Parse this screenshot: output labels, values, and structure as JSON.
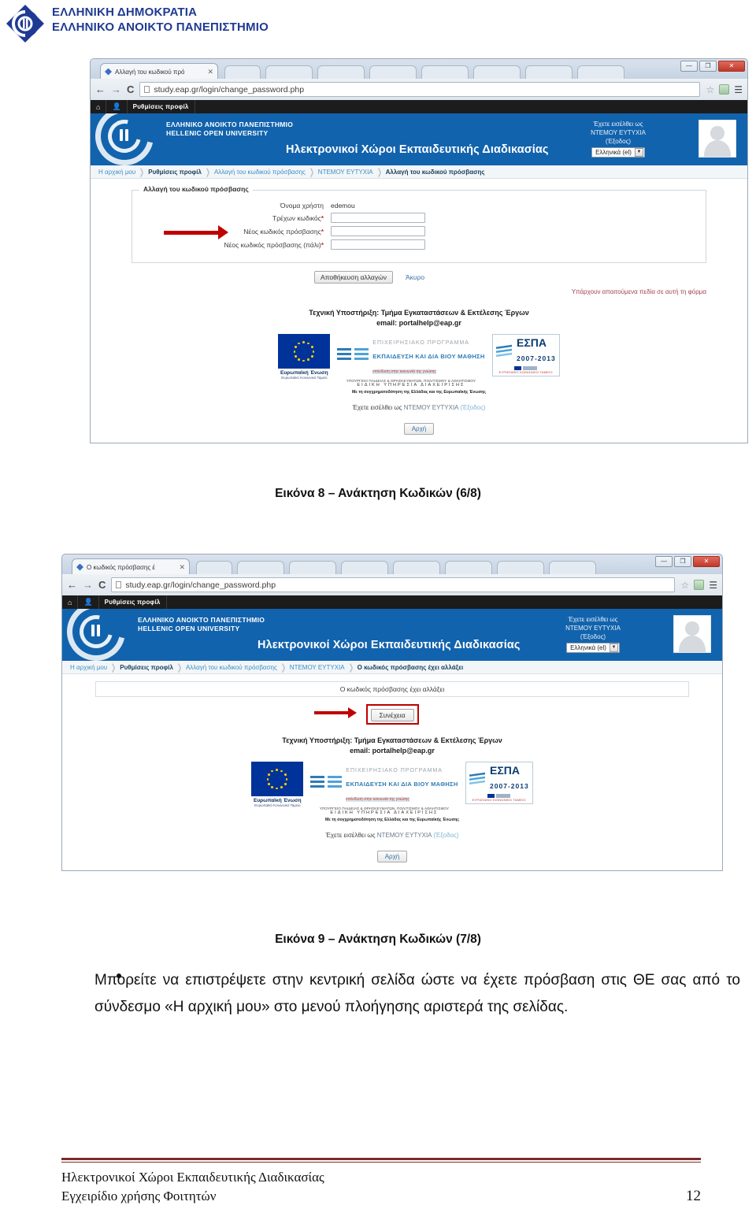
{
  "document_header": {
    "line1": "ΕΛΛΗΝΙΚΗ ΔΗΜΟΚΡΑΤΙΑ",
    "line2": "ΕΛΛΗΝΙΚΟ ΑΝΟΙΚΤΟ ΠΑΝΕΠΙΣΤΗΜΙΟ",
    "crest_icon": "eap-crest-icon",
    "brand_color": "#1f3a93"
  },
  "screenshot_1": {
    "tab": {
      "title": "Αλλαγή του κωδικού πρό",
      "close": "✕",
      "favicon": "moodle-favicon"
    },
    "window_controls": {
      "minimize": "—",
      "maximize": "❐",
      "close": "✕"
    },
    "toolbar": {
      "back": "←",
      "forward": "→",
      "reload": "C",
      "url": "study.eap.gr/login/change_password.php",
      "star": "☆",
      "extension": "extension-icon",
      "menu": "☰"
    },
    "custom_menu": {
      "home_icon": "home-icon",
      "user_icon": "user-icon",
      "profile_label": "Ρυθμίσεις προφίλ"
    },
    "site_header": {
      "logo": "eap-circle-logo",
      "uni_greek": "ΕΛΛΗΝΙΚΟ ΑΝΟΙΚΤΟ ΠΑΝΕΠΙΣΤΗΜΙΟ",
      "uni_english": "HELLENIC OPEN UNIVERSITY",
      "portal_title": "Ηλεκτρονικοί Χώροι Εκπαιδευτικής Διαδικασίας",
      "logged_in_as": "Έχετε εισέλθει ως",
      "user_name": "ΝΤΕΜΟΥ ΕΥΤΥΧΙΑ",
      "logout": "(Έξοδος)",
      "language": "Ελληνικά (el)",
      "language_arrow": "▼",
      "avatar": "user-avatar"
    },
    "breadcrumbs": [
      "Η αρχική μου",
      "Ρυθμίσεις προφίλ",
      "Αλλαγή του κωδικού πρόσβασης",
      "ΝΤΕΜΟΥ ΕΥΤΥΧΙΑ",
      "Αλλαγή του κωδικού πρόσβασης"
    ],
    "form": {
      "legend": "Αλλαγή του κωδικού πρόσβασης",
      "rows": [
        {
          "label": "Όνομα χρήστη",
          "required": "",
          "value": "edemou",
          "type": "text"
        },
        {
          "label": "Τρέχων κωδικός",
          "required": "*",
          "value": "",
          "type": "input"
        },
        {
          "label": "Νέος κωδικός πρόσβασης",
          "required": "*",
          "value": "",
          "type": "input"
        },
        {
          "label": "Νέος κωδικός πρόσβασης (πάλι)",
          "required": "*",
          "value": "",
          "type": "input"
        }
      ],
      "save_label": "Αποθήκευση αλλαγών",
      "cancel_label": "Άκυρο",
      "required_note": "Υπάρχουν απαιτούμενα πεδία σε αυτή τη φόρμα",
      "annotation_arrow": "red-arrow-annotation"
    },
    "support": {
      "line1": "Τεχνική Υποστήριξη: Τμήμα Εγκαταστάσεων & Εκτέλεσης Έργων",
      "line2": "email: portalhelp@eap.gr"
    },
    "espa": {
      "eu_label": "Ευρωπαϊκή Ένωση",
      "eu_sub": "Ευρωπαϊκό Κοινωνικό Ταμείο",
      "op_line1": "ΕΠΙΧΕΙΡΗΣΙΑΚΟ ΠΡΟΓΡΑΜΜΑ",
      "op_line2": "ΕΚΠΑΙΔΕΥΣΗ ΚΑΙ ΔΙΑ ΒΙΟΥ ΜΑΘΗΣΗ",
      "op_line3": "επένδυση στην κοινωνία της γνώσης",
      "ministry_line1": "ΥΠΟΥΡΓΕΙΟ ΠΑΙΔΕΙΑΣ & ΘΡΗΣΚΕΥΜΑΤΩΝ, ΠΟΛΙΤΙΣΜΟΥ & ΑΘΛΗΤΙΣΜΟΥ",
      "ministry_line2": "ΕΙΔΙΚΗ ΥΠΗΡΕΣΙΑ ΔΙΑΧΕΙΡΙΣΗΣ",
      "espa_name": "ΕΣΠΑ",
      "espa_years": "2007-2013",
      "espa_foot": "ΕΥΡΩΠΑΪΚΟ ΚΟΙΝΩΝΙΚΟ ΤΑΜΕΙΟ",
      "cofund": "Με τη συγχρηματοδότηση της Ελλάδας και της Ευρωπαϊκής Ένωσης"
    },
    "footer_line": {
      "prefix": "Έχετε εισέλθει ως",
      "user": "ΝΤΕΜΟΥ ΕΥΤΥΧΙΑ",
      "logout": "(Έξοδος)",
      "home_button": "Αρχή"
    }
  },
  "caption_1": "Εικόνα 8 – Ανάκτηση Κωδικών (6/8)",
  "screenshot_2": {
    "tab": {
      "title": "Ο κωδικός πρόσβασης έ",
      "close": "✕",
      "favicon": "moodle-favicon"
    },
    "window_controls": {
      "minimize": "—",
      "maximize": "❐",
      "close": "✕"
    },
    "toolbar": {
      "back": "←",
      "forward": "→",
      "reload": "C",
      "url": "study.eap.gr/login/change_password.php",
      "star": "☆",
      "extension": "extension-icon",
      "menu": "☰"
    },
    "custom_menu": {
      "home_icon": "home-icon",
      "user_icon": "user-icon",
      "profile_label": "Ρυθμίσεις προφίλ"
    },
    "site_header": {
      "logo": "eap-circle-logo",
      "uni_greek": "ΕΛΛΗΝΙΚΟ ΑΝΟΙΚΤΟ ΠΑΝΕΠΙΣΤΗΜΙΟ",
      "uni_english": "HELLENIC OPEN UNIVERSITY",
      "portal_title": "Ηλεκτρονικοί Χώροι Εκπαιδευτικής Διαδικασίας",
      "logged_in_as": "Έχετε εισέλθει ως",
      "user_name": "ΝΤΕΜΟΥ ΕΥΤΥΧΙΑ",
      "logout": "(Έξοδος)",
      "language": "Ελληνικά (el)",
      "language_arrow": "▼",
      "avatar": "user-avatar"
    },
    "breadcrumbs": [
      "Η αρχική μου",
      "Ρυθμίσεις προφίλ",
      "Αλλαγή του κωδικού πρόσβασης",
      "ΝΤΕΜΟΥ ΕΥΤΥΧΙΑ",
      "Ο κωδικός πρόσβασης έχει αλλάξει"
    ],
    "notice": "Ο κωδικός πρόσβασης έχει αλλάξει",
    "continue_label": "Συνέχεια",
    "annotation_arrow": "red-arrow-annotation",
    "support": {
      "line1": "Τεχνική Υποστήριξη: Τμήμα Εγκαταστάσεων & Εκτέλεσης Έργων",
      "line2": "email: portalhelp@eap.gr"
    },
    "espa": {
      "eu_label": "Ευρωπαϊκή Ένωση",
      "eu_sub": "Ευρωπαϊκό Κοινωνικό Ταμείο",
      "op_line1": "ΕΠΙΧΕΙΡΗΣΙΑΚΟ ΠΡΟΓΡΑΜΜΑ",
      "op_line2": "ΕΚΠΑΙΔΕΥΣΗ ΚΑΙ ΔΙΑ ΒΙΟΥ ΜΑΘΗΣΗ",
      "op_line3": "επένδυση στην κοινωνία της γνώσης",
      "ministry_line1": "ΥΠΟΥΡΓΕΙΟ ΠΑΙΔΕΙΑΣ & ΘΡΗΣΚΕΥΜΑΤΩΝ, ΠΟΛΙΤΙΣΜΟΥ & ΑΘΛΗΤΙΣΜΟΥ",
      "ministry_line2": "ΕΙΔΙΚΗ ΥΠΗΡΕΣΙΑ ΔΙΑΧΕΙΡΙΣΗΣ",
      "espa_name": "ΕΣΠΑ",
      "espa_years": "2007-2013",
      "espa_foot": "ΕΥΡΩΠΑΪΚΟ ΚΟΙΝΩΝΙΚΟ ΤΑΜΕΙΟ",
      "cofund": "Με τη συγχρηματοδότηση της Ελλάδας και της Ευρωπαϊκής Ένωσης"
    },
    "footer_line": {
      "prefix": "Έχετε εισέλθει ως",
      "user": "ΝΤΕΜΟΥ ΕΥΤΥΧΙΑ",
      "logout": "(Έξοδος)",
      "home_button": "Αρχή"
    }
  },
  "caption_2": "Εικόνα 9 – Ανάκτηση Κωδικών (7/8)",
  "body_bullet": "Μπορείτε να επιστρέψετε στην κεντρική σελίδα ώστε να έχετε πρόσβαση στις ΘΕ σας από το σύνδεσμο «Η αρχική μου» στο μενού πλοήγησης αριστερά της σελίδας.",
  "page_footer": {
    "line1": "Ηλεκτρονικοί Χώροι Εκπαιδευτικής Διαδικασίας",
    "line2": "Εγχειρίδιο χρήσης Φοιτητών",
    "page_number": "12",
    "rule_color": "#7b2b2b"
  }
}
